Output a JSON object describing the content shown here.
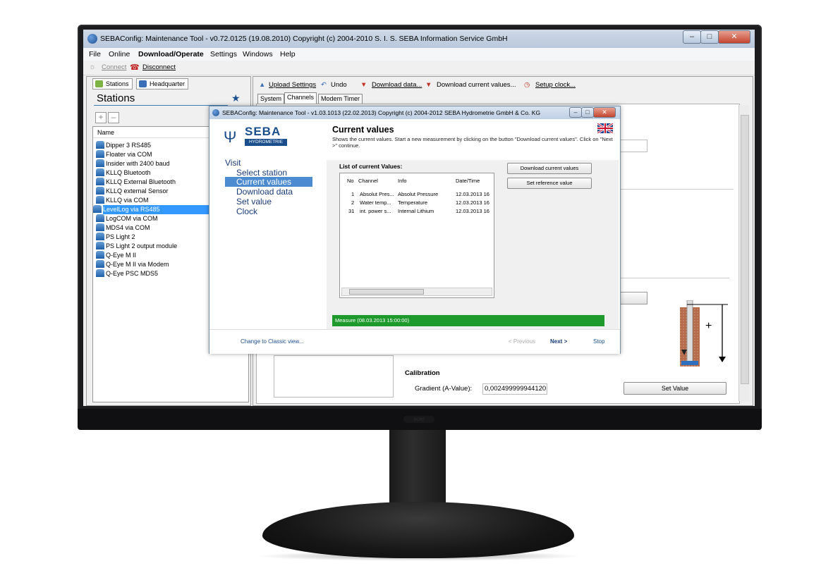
{
  "window": {
    "title": "SEBAConfig: Maintenance Tool - v0.72.0125 (19.08.2010) Copyright (c) 2004-2010 S. I. S. SEBA Information Service GmbH"
  },
  "menu": [
    "File",
    "Online",
    "Download/Operate",
    "Settings",
    "Windows",
    "Help"
  ],
  "toolbar": {
    "connect": "Connect",
    "disconnect": "Disconnect"
  },
  "left_tabs": [
    "Stations",
    "Headquarter"
  ],
  "stations": {
    "title": "Stations",
    "column_header": "Name",
    "items": [
      "Dipper 3 RS485",
      "Floater via COM",
      "Insider with 2400 baud",
      "KLLQ Bluetooth",
      "KLLQ External Bluetooth",
      "KLLQ external Sensor",
      "KLLQ via COM",
      "LevelLog via RS485",
      "LogCOM via COM",
      "MDS4 via COM",
      "PS Light 2",
      "PS Light 2 output module",
      "Q-Eye M II",
      "Q-Eye M II via Modem",
      "Q-Eye PSC MDS5"
    ],
    "selected": "LevelLog via RS485"
  },
  "right_toolbar": {
    "upload": "Upload Settings",
    "undo": "Undo",
    "download_data": "Download data...",
    "download_current": "Download current values...",
    "setup_clock": "Setup clock..."
  },
  "subtabs": [
    "System",
    "Channels",
    "Modem Timer"
  ],
  "dialog": {
    "title": "SEBAConfig: Maintenance Tool - v1.03.1013 (22.02.2013) Copyright (c) 2004-2012 SEBA Hydrometrie GmbH & Co. KG",
    "logo_text": "SEBA",
    "logo_sub": "HYDROMETRIE",
    "wizard": {
      "root": "Visit",
      "items": [
        "Select station",
        "Current values",
        "Download data",
        "Set value",
        "Clock"
      ],
      "active": "Current values"
    },
    "header": {
      "title": "Current values",
      "description": "Shows the current values. Start a new measurement by clicking on the button \"Download current values\". Click on \"Next >\" continue."
    },
    "list_label": "List of current Values:",
    "columns": [
      "No",
      "Channel",
      "Info",
      "Date/Time"
    ],
    "rows": [
      [
        "1",
        "Absolut Pres...",
        "Absolut Pressure",
        "12.03.2013 16"
      ],
      [
        "2",
        "Water temp...",
        "Temperature",
        "12.03.2013 16"
      ],
      [
        "31",
        "int. power s...",
        "Internal Lithium",
        "12.03.2013 16"
      ]
    ],
    "buttons": {
      "download": "Download current values",
      "reference": "Set reference value"
    },
    "status": "Measure (08.03.2013 15:00:00)",
    "footer": {
      "classic": "Change to Classic view...",
      "previous": "< Previous",
      "next": "Next >",
      "stop": "Stop"
    }
  },
  "calibration": {
    "label": "Calibration",
    "gradient_label": "Gradient (A-Value):",
    "gradient_value": "0,002499999944120",
    "set_button": "Set Value"
  },
  "gauge_symbol": "+"
}
